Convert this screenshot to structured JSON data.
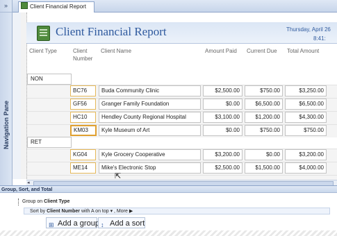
{
  "nav": {
    "toggle": "»",
    "label": "Navigation Pane"
  },
  "tab": {
    "label": "Client Financial Report"
  },
  "report": {
    "title": "Client Financial Report",
    "date": "Thursday, April 26",
    "time": "8:41:"
  },
  "columns": {
    "client_type": "Client Type",
    "client_number_1": "Client",
    "client_number_2": "Number",
    "client_name": "Client Name",
    "amount_paid": "Amount Paid",
    "current_due": "Current Due",
    "total_amount": "Total Amount"
  },
  "groups": [
    {
      "type": "NON",
      "rows": [
        {
          "number": "BC76",
          "name": "Buda Community Clinic",
          "paid": "$2,500.00",
          "due": "$750.00",
          "total": "$3,250.00"
        },
        {
          "number": "GF56",
          "name": "Granger Family Foundation",
          "paid": "$0.00",
          "due": "$6,500.00",
          "total": "$6,500.00"
        },
        {
          "number": "HC10",
          "name": "Hendley County Regional Hospital",
          "paid": "$3,100.00",
          "due": "$1,200.00",
          "total": "$4,300.00"
        },
        {
          "number": "KM03",
          "name": "Kyle Museum of Art",
          "paid": "$0.00",
          "due": "$750.00",
          "total": "$750.00"
        }
      ]
    },
    {
      "type": "RET",
      "rows": [
        {
          "number": "KG04",
          "name": "Kyle Grocery Cooperative",
          "paid": "$3,200.00",
          "due": "$0.00",
          "total": "$3,200.00"
        },
        {
          "number": "ME14",
          "name": "Mike's Electronic Stop",
          "paid": "$2,500.00",
          "due": "$1,500.00",
          "total": "$4,000.00"
        }
      ]
    }
  ],
  "scroll": {
    "left_arrow": "◂",
    "mid": "III"
  },
  "gst": {
    "title": "Group, Sort, and Total",
    "group_prefix": "Group on",
    "group_field": "Client Type",
    "sort_prefix": "Sort by",
    "sort_field": "Client Number",
    "sort_order": "with A on top ▾",
    "more": ", More ▶",
    "add_group": "Add a group",
    "add_sort": "Add a sort"
  }
}
